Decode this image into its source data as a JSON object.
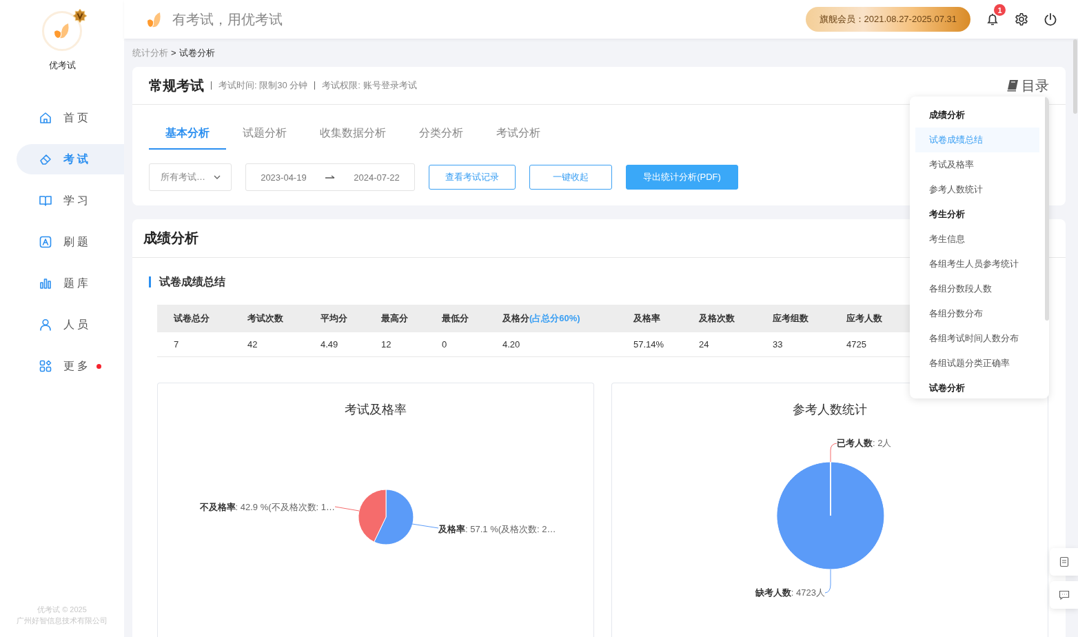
{
  "sidebar": {
    "brand": "优考试",
    "items": [
      {
        "label": "首 页",
        "selected": false,
        "dot": false
      },
      {
        "label": "考 试",
        "selected": true,
        "dot": false
      },
      {
        "label": "学 习",
        "selected": false,
        "dot": false
      },
      {
        "label": "刷 题",
        "selected": false,
        "dot": false
      },
      {
        "label": "题 库",
        "selected": false,
        "dot": false
      },
      {
        "label": "人 员",
        "selected": false,
        "dot": false
      },
      {
        "label": "更 多",
        "selected": false,
        "dot": true
      }
    ],
    "footer": [
      "优考试 © 2025",
      "广州好智信息技术有限公司"
    ]
  },
  "header": {
    "slogan": "有考试，用优考试",
    "membership": "旗舰会员：2021.08.27-2025.07.31",
    "notifications": "1"
  },
  "breadcrumb": {
    "items": [
      {
        "label": "统计分析",
        "current": false
      },
      {
        "label": "试卷分析",
        "current": true
      }
    ],
    "separator": ">"
  },
  "exam": {
    "title": "常规考试",
    "meta": [
      "考试时间: 限制30 分钟",
      "考试权限: 账号登录考试"
    ],
    "toc_label": "目录"
  },
  "tabs": [
    {
      "label": "基本分析",
      "selected": true
    },
    {
      "label": "试题分析",
      "selected": false
    },
    {
      "label": "收集数据分析",
      "selected": false
    },
    {
      "label": "分类分析",
      "selected": false
    },
    {
      "label": "考试分析",
      "selected": false
    }
  ],
  "filters": {
    "exam_select": "所有考试…",
    "date_from": "2023-04-19",
    "date_to": "2024-07-22"
  },
  "buttons": [
    {
      "label": "查看考试记录",
      "kind": "outline"
    },
    {
      "label": "一键收起",
      "kind": "outline"
    },
    {
      "label": "导出统计分析(PDF)",
      "kind": "primary"
    }
  ],
  "score_section": {
    "title": "成绩分析",
    "subtitle": "试卷成绩总结",
    "table": {
      "columns": [
        {
          "label": "试卷总分"
        },
        {
          "label": "考试次数"
        },
        {
          "label": "平均分"
        },
        {
          "label": "最高分"
        },
        {
          "label": "最低分"
        },
        {
          "label": "及格分",
          "note": "(占总分60%)"
        },
        {
          "label": "及格率"
        },
        {
          "label": "及格次数"
        },
        {
          "label": "应考组数"
        },
        {
          "label": "应考人数"
        }
      ],
      "rows": [
        [
          "7",
          "42",
          "4.49",
          "12",
          "0",
          "4.20",
          "57.14%",
          "24",
          "33",
          "4725"
        ]
      ]
    }
  },
  "charts": [
    {
      "chart_data": {
        "type": "pie",
        "title": "考试及格率",
        "categories": [
          "及格率",
          "不及格率"
        ],
        "values": [
          57.1,
          42.9
        ],
        "colors": [
          "#5b9bf8",
          "#f56c6c"
        ],
        "value_labels": [
          ": 57.1 %(及格次数: 2…",
          ": 42.9 %(不及格次数: 1…"
        ]
      }
    },
    {
      "chart_data": {
        "type": "pie",
        "title": "参考人数统计",
        "categories": [
          "缺考人数",
          "已考人数"
        ],
        "values": [
          4723,
          2
        ],
        "colors": [
          "#5b9bf8",
          "#f56c6c"
        ],
        "value_labels": [
          ": 4723人",
          ": 2人"
        ]
      }
    }
  ],
  "toc": {
    "items": [
      {
        "label": "成绩分析",
        "kind": "heading",
        "selected": false
      },
      {
        "label": "试卷成绩总结",
        "kind": "item",
        "selected": true
      },
      {
        "label": "考试及格率",
        "kind": "item",
        "selected": false
      },
      {
        "label": "参考人数统计",
        "kind": "item",
        "selected": false
      },
      {
        "label": "考生分析",
        "kind": "heading",
        "selected": false
      },
      {
        "label": "考生信息",
        "kind": "item",
        "selected": false
      },
      {
        "label": "各组考生人员参考统计",
        "kind": "item",
        "selected": false
      },
      {
        "label": "各组分数段人数",
        "kind": "item",
        "selected": false
      },
      {
        "label": "各组分数分布",
        "kind": "item",
        "selected": false
      },
      {
        "label": "各组考试时间人数分布",
        "kind": "item",
        "selected": false
      },
      {
        "label": "各组试题分类正确率",
        "kind": "item",
        "selected": false
      },
      {
        "label": "试卷分析",
        "kind": "heading",
        "selected": false
      }
    ]
  }
}
